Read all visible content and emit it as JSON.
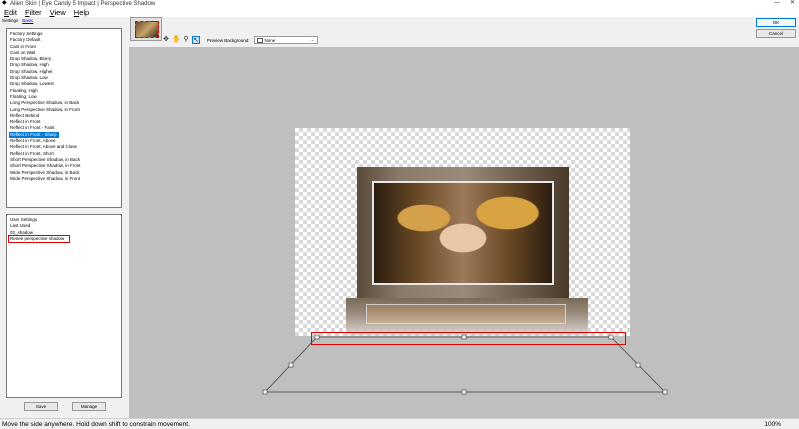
{
  "window": {
    "title": "Alien Skin | Eye Candy 5 Impact | Perspective Shadow",
    "controls": [
      "—",
      "✕"
    ]
  },
  "menu": [
    {
      "label": "Edit",
      "u": "E",
      "rest": "dit"
    },
    {
      "label": "Filter",
      "u": "F",
      "rest": "ilter"
    },
    {
      "label": "View",
      "u": "V",
      "rest": "iew"
    },
    {
      "label": "Help",
      "u": "H",
      "rest": "elp"
    }
  ],
  "tabs": {
    "settings": "Settings",
    "basic": "Basic"
  },
  "factory_settings": [
    "Factory Settings",
    "Factory Default",
    "Cast in Front",
    "Cast on Wall",
    "Drop Shadow, Blurry",
    "Drop Shadow, High",
    "Drop Shadow, Higher",
    "Drop Shadow, Low",
    "Drop Shadow, Lowest",
    "Floating, High",
    "Floating, Low",
    "Long Perspective Shadow, in Back",
    "Long Perspective Shadow, in Front",
    "Reflect Behind",
    "Reflect in Front",
    "Reflect in Front - Faint",
    "Reflect in Front - Sharp",
    "Reflect in Front, Above",
    "Reflect in Front, Above and Close",
    "Reflect in Front, Short",
    "Short Perspective Shadow, in Back",
    "Short Perspective Shadow, in Front",
    "Wide Perspective Shadow, in Back",
    "Wide Perspective Shadow, in Front"
  ],
  "selected_factory_index": 16,
  "user_settings": [
    "User Settings",
    "Last Used",
    "02_shadow",
    "Renee perspective shadow"
  ],
  "buttons": {
    "save": "Save",
    "manage": "Manage",
    "ok": "OK",
    "cancel": "Cancel"
  },
  "toolbar": {
    "tools": [
      "move-icon",
      "hand-icon",
      "zoom-icon",
      "pointer-icon"
    ],
    "preview_bg_label": "Preview Background:",
    "preview_bg_value": "None"
  },
  "status": {
    "message": "Move the side anywhere. Hold down shift to constrain movement.",
    "zoom": "100%"
  },
  "colors": {
    "selection": "#0078d7",
    "highlight_box": "#e00000"
  }
}
